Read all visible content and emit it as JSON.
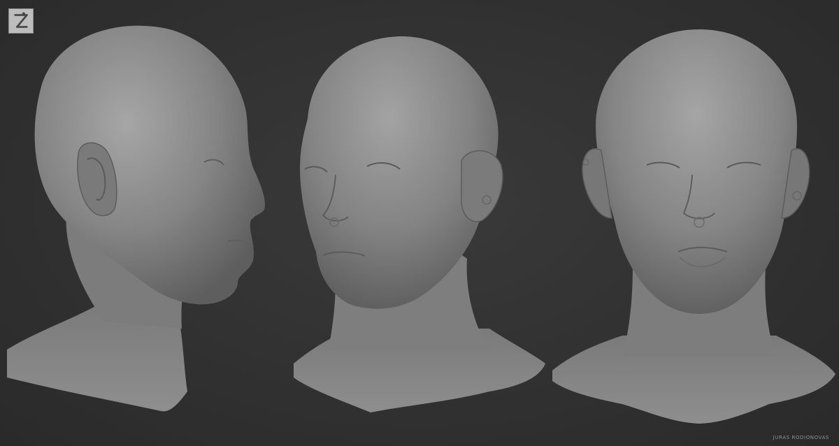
{
  "logo": {
    "icon": "zbrush-logo-icon",
    "colors": {
      "tile": "#bdbdbd",
      "mark": "#4a4a4a"
    }
  },
  "image": {
    "background_color": "#2e2e2e",
    "sculpt_color": "#8e8e8e",
    "views": [
      "side-profile",
      "three-quarter",
      "front"
    ]
  },
  "signature": {
    "text": "JURAS RODIONOVAS"
  }
}
